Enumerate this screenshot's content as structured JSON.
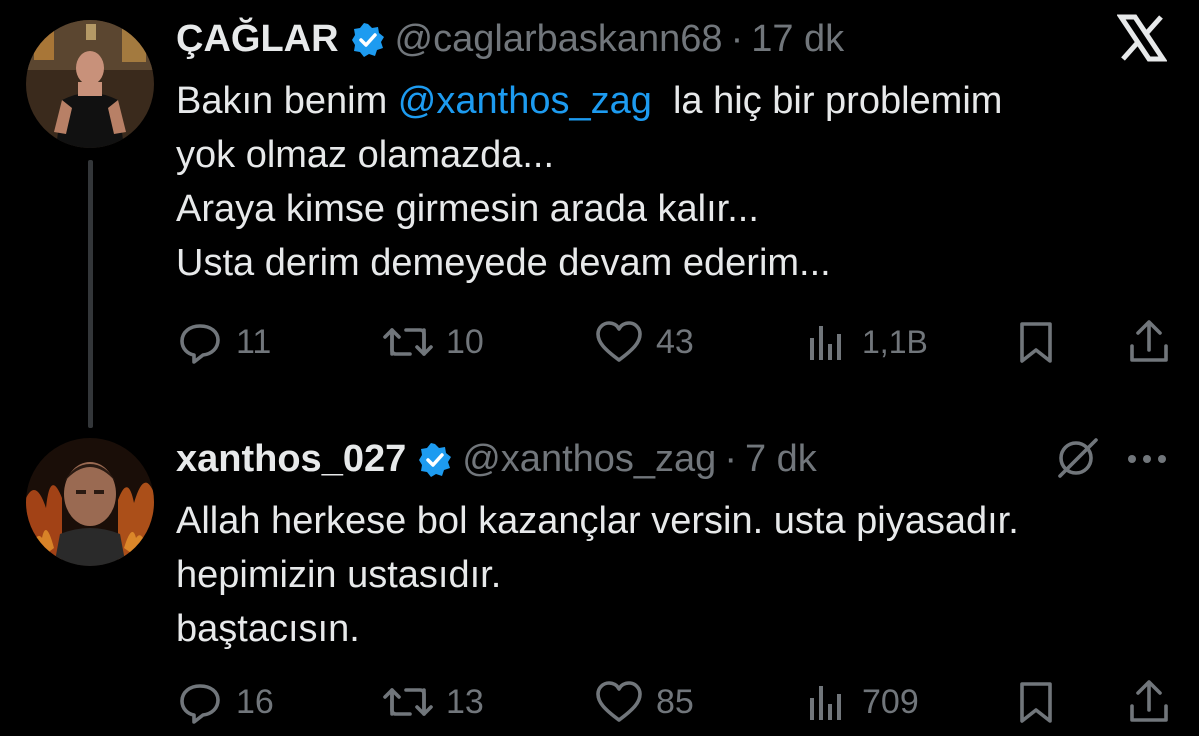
{
  "brand_logo": "x-logo",
  "tweets": [
    {
      "name": "ÇAĞLAR",
      "handle": "@caglarbaskann68",
      "separator": "·",
      "time": "17 dk",
      "text_part1": "Bakın benim ",
      "mention": "@xanthos_zag",
      "text_part2": "  la hiç bir problemim",
      "lines": [
        "yok olmaz olamazda...",
        "Araya kimse girmesin arada kalır...",
        "Usta derim demeyede devam ederim..."
      ],
      "replies": "11",
      "retweets": "10",
      "likes": "43",
      "views": "1,1B"
    },
    {
      "name": "xanthos_027",
      "handle": "@xanthos_zag",
      "separator": "·",
      "time": "7 dk",
      "lines": [
        "Allah herkese bol kazançlar versin. usta piyasadır.",
        "hepimizin ustasıdır.",
        "baştacısın."
      ],
      "replies": "16",
      "retweets": "13",
      "likes": "85",
      "views": "709"
    }
  ],
  "colors": {
    "background": "#000000",
    "text": "#e7e9ea",
    "muted": "#71767b",
    "accent": "#1d9bf0"
  }
}
